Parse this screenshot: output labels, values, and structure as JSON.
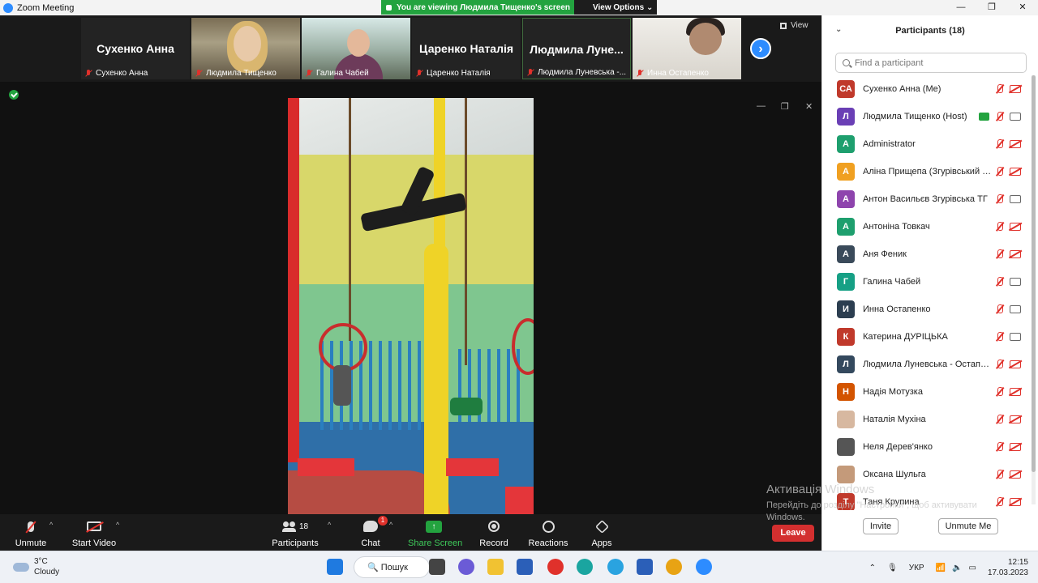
{
  "window": {
    "title": "Zoom Meeting",
    "share_banner": "You are viewing Людмила Тищенко's screen",
    "view_options": "View Options",
    "controls": [
      "—",
      "❐",
      "✕"
    ]
  },
  "strip": {
    "view_label": "View",
    "tiles": [
      {
        "big_name": "Сухенко Анна",
        "caption": "Сухенко Анна",
        "video": false
      },
      {
        "big_name": "",
        "caption": "Людмила Тищенко",
        "video": true
      },
      {
        "big_name": "",
        "caption": "Галина Чабей",
        "video": true
      },
      {
        "big_name": "Царенко Наталія",
        "caption": "Царенко Наталія",
        "video": false
      },
      {
        "big_name": "Людмила Луне...",
        "caption": "Людмила Луневська -...",
        "video": false,
        "active": true
      },
      {
        "big_name": "",
        "caption": "Инна Остапенко",
        "video": true
      }
    ]
  },
  "toolbar": {
    "unmute": "Unmute",
    "start_video": "Start Video",
    "participants_label": "Participants",
    "participants_count": "18",
    "chat": "Chat",
    "chat_badge": "1",
    "share_screen": "Share Screen",
    "record": "Record",
    "reactions": "Reactions",
    "apps": "Apps",
    "leave": "Leave"
  },
  "panel": {
    "title": "Participants (18)",
    "search_placeholder": "Find a participant",
    "invite": "Invite",
    "unmute_me": "Unmute Me",
    "participants": [
      {
        "initials": "СА",
        "name": "Сухенко Анна (Me)",
        "color": "#c0392b",
        "cam": "off"
      },
      {
        "initials": "Л",
        "name": "Людмила Тищенко (Host)",
        "color": "#6a3fb5",
        "cam": "on",
        "sharing": true
      },
      {
        "initials": "A",
        "name": "Administrator",
        "color": "#1e9f6e",
        "cam": "off"
      },
      {
        "initials": "А",
        "name": "Аліна Прищепа (Згурівський БД...",
        "color": "#f0a021",
        "cam": "off"
      },
      {
        "initials": "А",
        "name": "Антон Васильєв Згурівська ТГ",
        "color": "#8e44ad",
        "cam": "on"
      },
      {
        "initials": "А",
        "name": "Антоніна Товкач",
        "color": "#1e9f6e",
        "cam": "off"
      },
      {
        "initials": "А",
        "name": "Аня Феник",
        "color": "#3a4a5a",
        "cam": "off"
      },
      {
        "initials": "Г",
        "name": "Галина Чабей",
        "color": "#16a085",
        "cam": "on"
      },
      {
        "initials": "И",
        "name": "Инна Остапенко",
        "color": "#2c3e50",
        "cam": "on"
      },
      {
        "initials": "К",
        "name": "Катерина ДУРІЦЬКА",
        "color": "#c0392b",
        "cam": "on"
      },
      {
        "initials": "Л",
        "name": "Людмила Луневська - Остапенко",
        "color": "#34495e",
        "cam": "off"
      },
      {
        "initials": "Н",
        "name": "Надія Мотузка",
        "color": "#d35400",
        "cam": "off"
      },
      {
        "initials": "",
        "name": "Наталія Мухіна",
        "color": "#d7b8a0",
        "cam": "off"
      },
      {
        "initials": "",
        "name": "Неля Дерев'янко",
        "color": "#555555",
        "cam": "off"
      },
      {
        "initials": "",
        "name": "Оксана  Шульга",
        "color": "#c49a7a",
        "cam": "off"
      },
      {
        "initials": "Т",
        "name": "Таня Крупина",
        "color": "#c0392b",
        "cam": "off"
      }
    ]
  },
  "watermark": {
    "title": "Активація Windows",
    "text": "Перейдіть до розділу \"Настройки\", щоб активувати Windows."
  },
  "taskbar": {
    "temp": "3°C",
    "weather": "Cloudy",
    "search": "Пошук",
    "lang": "УКР",
    "time": "12:15",
    "date": "17.03.2023"
  }
}
